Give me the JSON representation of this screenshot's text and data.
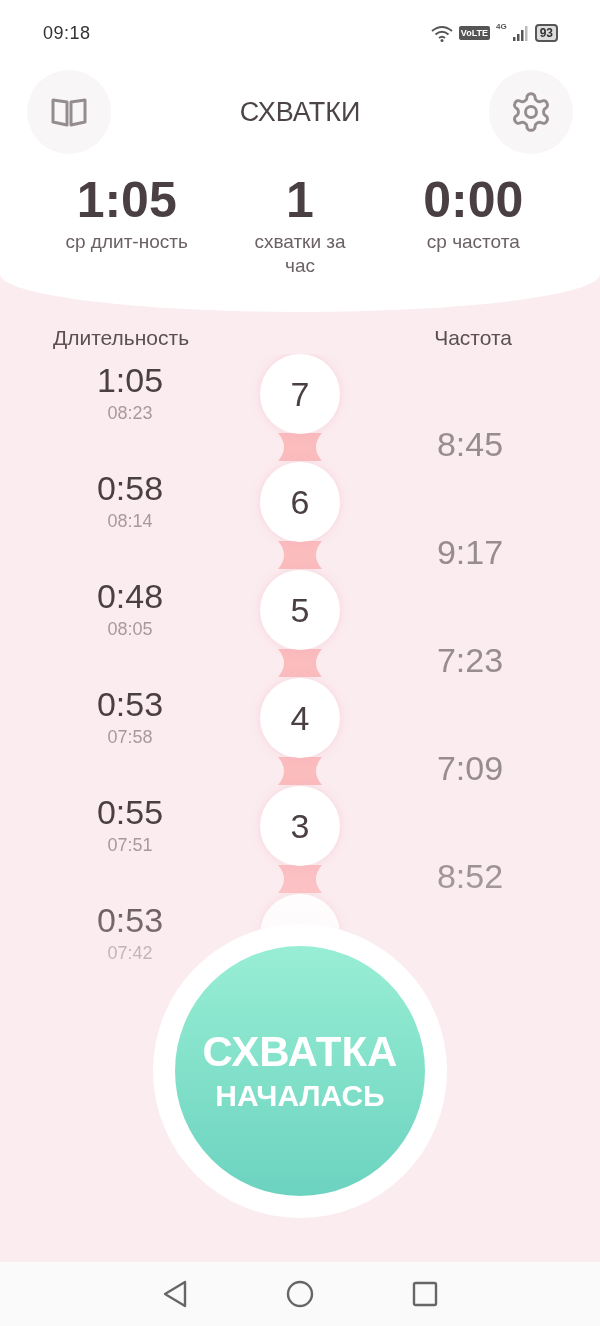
{
  "status_bar": {
    "time": "09:18",
    "volte": "VoLTE",
    "network": "4G",
    "battery": "93"
  },
  "header": {
    "title": "СХВАТКИ"
  },
  "stats": [
    {
      "value": "1:05",
      "label": "ср длит-ность"
    },
    {
      "value": "1",
      "label": "схватки за час"
    },
    {
      "value": "0:00",
      "label": "ср частота"
    }
  ],
  "columns": {
    "duration": "Длительность",
    "frequency": "Частота"
  },
  "contractions": [
    {
      "number": "7",
      "duration": "1:05",
      "start": "08:23",
      "frequency": "8:45"
    },
    {
      "number": "6",
      "duration": "0:58",
      "start": "08:14",
      "frequency": "9:17"
    },
    {
      "number": "5",
      "duration": "0:48",
      "start": "08:05",
      "frequency": "7:23"
    },
    {
      "number": "4",
      "duration": "0:53",
      "start": "07:58",
      "frequency": "7:09"
    },
    {
      "number": "3",
      "duration": "0:55",
      "start": "07:51",
      "frequency": "8:52"
    },
    {
      "duration": "0:53",
      "start": "07:42"
    }
  ],
  "start_button": {
    "line1": "СХВАТКА",
    "line2": "НАЧАЛАСЬ"
  }
}
